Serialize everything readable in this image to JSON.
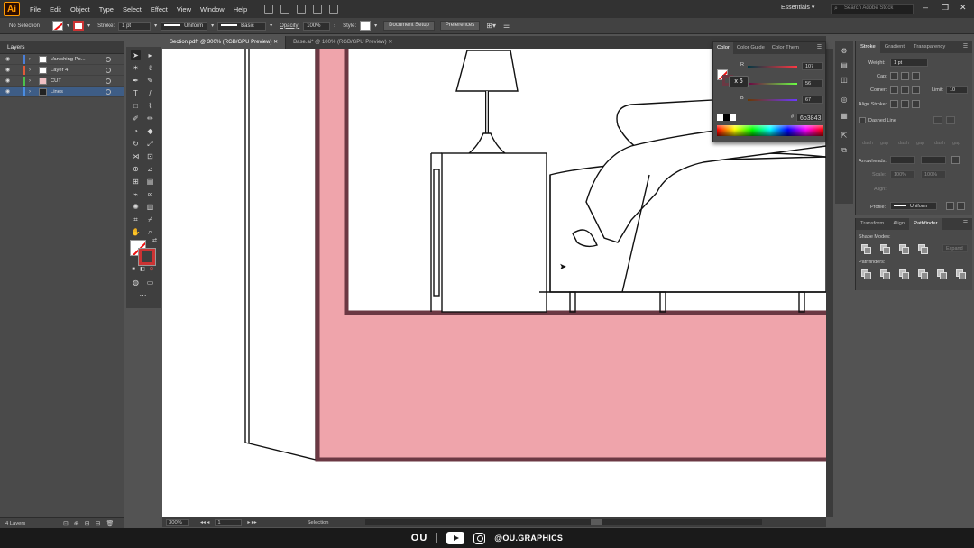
{
  "app": {
    "logo": "Ai",
    "menus": [
      "File",
      "Edit",
      "Object",
      "Type",
      "Select",
      "Effect",
      "View",
      "Window",
      "Help"
    ],
    "workspace": "Essentials",
    "search_placeholder": "Search Adobe Stock",
    "window_controls": [
      "–",
      "❐",
      "✕"
    ]
  },
  "control_bar": {
    "selection": "No Selection",
    "stroke_label": "Stroke:",
    "stroke_value": "1 pt",
    "uniform": "Uniform",
    "basic": "Basic",
    "opacity_label": "Opacity:",
    "opacity_value": "100%",
    "style_label": "Style:",
    "document_setup": "Document Setup",
    "preferences": "Preferences"
  },
  "layers": {
    "title": "Layers",
    "items": [
      {
        "name": "Vanishing Po...",
        "color": "#4a7fd8",
        "selected": false
      },
      {
        "name": "Layer 4",
        "color": "#e05a3a",
        "selected": false
      },
      {
        "name": "CUT",
        "color": "#4bc04b",
        "selected": false
      },
      {
        "name": "Lines",
        "color": "#4a8ce0",
        "selected": true
      }
    ],
    "footer": "4 Layers"
  },
  "documents": {
    "tabs": [
      {
        "label": "Section.pdf* @ 300% (RGB/GPU Preview)",
        "active": true
      },
      {
        "label": "Base.ai* @ 100% (RGB/GPU Preview)",
        "active": false
      }
    ],
    "zoom": "300%",
    "artboard": "1",
    "status_tool": "Selection"
  },
  "color_panel": {
    "tabs": [
      "Color",
      "Color Guide",
      "Color Them"
    ],
    "r": {
      "label": "R",
      "value": "107"
    },
    "g": {
      "label": "G",
      "value": "56"
    },
    "b": {
      "label": "B",
      "value": "67"
    },
    "hex_label": "#",
    "hex": "6b3843",
    "tooltip": "x 6"
  },
  "stroke_panel": {
    "tabs": [
      "Stroke",
      "Gradient",
      "Transparency"
    ],
    "weight_label": "Weight:",
    "weight_value": "1 pt",
    "cap_label": "Cap:",
    "corner_label": "Corner:",
    "limit_label": "Limit:",
    "limit_value": "10",
    "align_label": "Align Stroke:",
    "dashed_label": "Dashed Line",
    "dash_labels": [
      "dash",
      "gap",
      "dash",
      "gap",
      "dash",
      "gap"
    ],
    "arrowheads_label": "Arrowheads:",
    "scale_label": "Scale:",
    "scale_value_1": "100%",
    "scale_value_2": "100%",
    "align_arrow_label": "Align:",
    "profile_label": "Profile:",
    "profile_value": "Uniform"
  },
  "pathfinder_panel": {
    "tabs": [
      "Transform",
      "Align",
      "Pathfinder"
    ],
    "shape_modes": "Shape Modes:",
    "pathfinders": "Pathfinders:",
    "expand": "Expand"
  },
  "brand": {
    "logo": "OU",
    "handle": "@OU.GRAPHICS"
  },
  "colors": {
    "pink_fill": "#efa4ab",
    "frame_stroke": "#6b3843",
    "line": "#111111"
  }
}
